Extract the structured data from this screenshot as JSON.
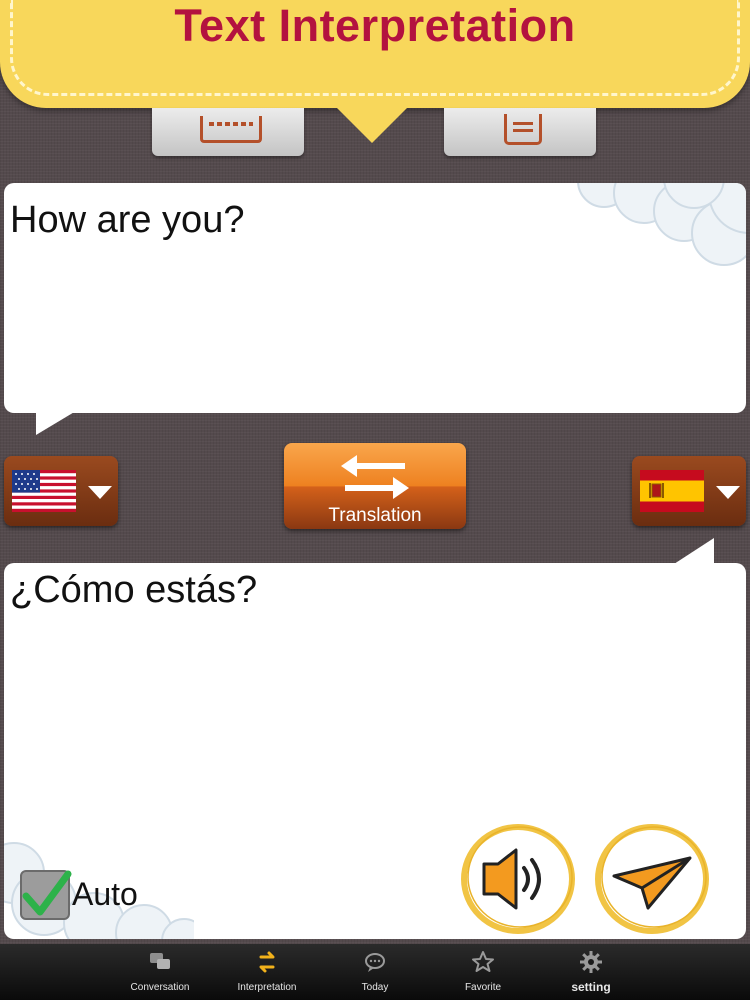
{
  "header": {
    "title": "Text Interpretation"
  },
  "source": {
    "text": "How are you?",
    "language_flag": "us-flag"
  },
  "target": {
    "text": "¿Cómo estás?",
    "language_flag": "spain-flag"
  },
  "translate_button": {
    "label": "Translation"
  },
  "auto_option": {
    "label": "Auto",
    "checked": true
  },
  "tabbar": {
    "items": [
      {
        "label": "Conversation",
        "icon": "chat-bubbles-icon"
      },
      {
        "label": "Interpretation",
        "icon": "swap-arrows-icon",
        "active": true
      },
      {
        "label": "Today",
        "icon": "speech-bubble-icon"
      },
      {
        "label": "Favorite",
        "icon": "star-icon"
      },
      {
        "label": "setting",
        "icon": "gear-icon"
      }
    ]
  },
  "colors": {
    "banner": "#f8d75b",
    "title": "#b3123f",
    "accent_orange": "#ee8120",
    "background": "#544a4d"
  }
}
